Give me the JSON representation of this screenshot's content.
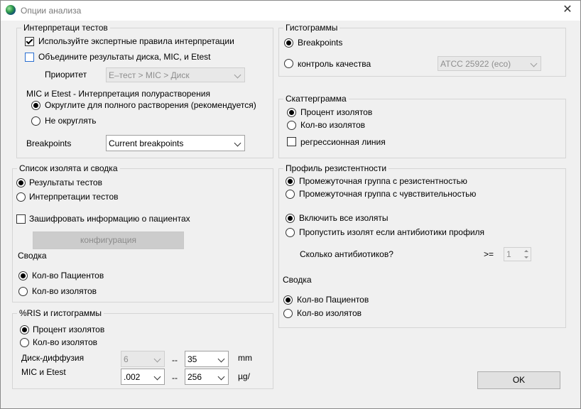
{
  "window": {
    "title": "Опции анализа",
    "close_glyph": "✕"
  },
  "interp": {
    "title": "Интерпретаци тестов",
    "expert_rules": "Используйте экспертные правила интерпретации",
    "combine": "Объедините результаты диска, MIC, и Etest",
    "priority_label": "Приоритет",
    "priority_value": "E–тест > MIC > Диск",
    "mic_title": "MIC и Etest - Интерпретация полурастворения",
    "round": "Округлите для полного растворения (рекомендуется)",
    "no_round": "Не округлять",
    "breakpoints_label": "Breakpoints",
    "breakpoints_value": "Current breakpoints"
  },
  "isolates": {
    "title": "Список изолята и сводка",
    "test_results": "Результаты тестов",
    "test_interp": "Интерпретации тестов",
    "encrypt": "Зашифровать информацию о пациентах",
    "config_button": "конфигурация",
    "summary_label": "Сводка",
    "patients": "Кол-во Пациентов",
    "isolates_count": "Кол-во изолятов"
  },
  "ris": {
    "title": "%RIS и гистограммы",
    "percent": "Процент изолятов",
    "count": "Кол-во изолятов",
    "disk_label": "Диск-диффузия",
    "disk_from": "6",
    "disk_sep": "--",
    "disk_to": "35",
    "disk_unit": "mm",
    "mic_label": "MIC и Etest",
    "mic_from": ".002",
    "mic_sep": "--",
    "mic_to": "256",
    "mic_unit": "µg/"
  },
  "histograms": {
    "title": "Гистограммы",
    "breakpoints": "Breakpoints",
    "quality": "контроль качества",
    "atcc_value": "ATCC 25922  (eco)"
  },
  "scatter": {
    "title": "Скаттерграмма",
    "percent": "Процент изолятов",
    "count": "Кол-во изолятов",
    "regression": "регрессионная линия"
  },
  "profile": {
    "title": "Профиль резистентности",
    "intermediate_resistant": "Промежуточная группа с резистентностью",
    "intermediate_sensitive": "Промежуточная группа с чувствительностью",
    "include_all": "Включить все изоляты",
    "skip": "Пропустить изолят если антибиотики профиля",
    "how_many": "Сколько антибиотиков?",
    "ge": ">=",
    "spin_value": "1",
    "summary_label": "Сводка",
    "patients": "Кол-во Пациентов",
    "isolates_count": "Кол-во изолятов"
  },
  "ok_label": "OK"
}
